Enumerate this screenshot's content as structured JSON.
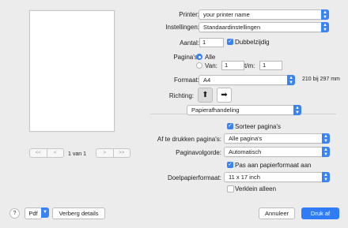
{
  "preview": {
    "nav": [
      "<<",
      "<",
      ">",
      ">>"
    ],
    "page_count": "1 van 1"
  },
  "printer": {
    "label": "Printer:",
    "value": "your printer name"
  },
  "presets": {
    "label": "Instellingen:",
    "value": "Standaardinstellingen"
  },
  "copies": {
    "label": "Aantal:",
    "value": "1",
    "duplex_label": "Dubbelzijdig"
  },
  "pages": {
    "label": "Pagina's:",
    "all_label": "Alle",
    "from_label": "Van:",
    "from_value": "1",
    "to_label": "t/m:",
    "to_value": "1"
  },
  "paper": {
    "label": "Formaat:",
    "value": "A4",
    "dimensions": "210 bij 297 mm"
  },
  "orientation": {
    "label": "Richting:",
    "portrait_glyph": "⬆",
    "landscape_glyph": "➡"
  },
  "section": {
    "value": "Papierafhandeling"
  },
  "collate": {
    "label": "Sorteer pagina's"
  },
  "pages_to_print": {
    "label": "Af te drukken pagina's:",
    "value": "Alle pagina's"
  },
  "page_order": {
    "label": "Paginavolgorde:",
    "value": "Automatisch"
  },
  "scale_fit": {
    "label": "Pas aan papierformaat aan"
  },
  "dest_paper": {
    "label": "Doelpapierformaat:",
    "value": "11 x 17 inch"
  },
  "scale_down": {
    "label": "Verklein alleen"
  },
  "footer": {
    "help": "?",
    "pdf": "Pdf",
    "details": "Verberg details",
    "cancel": "Annuleer",
    "print": "Druk af"
  },
  "colors": {
    "accent": "#3a83f5",
    "background": "#ececec"
  }
}
